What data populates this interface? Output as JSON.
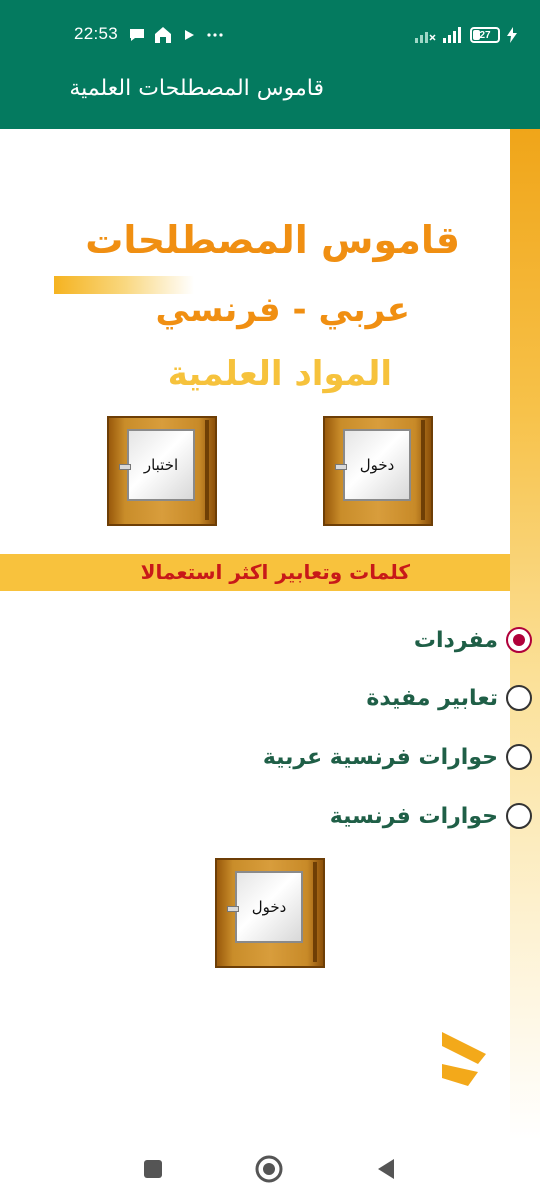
{
  "status_bar": {
    "time": "22:53",
    "battery": "27",
    "icons": [
      "chat-icon",
      "home-icon",
      "play-icon",
      "more-dots-icon",
      "signal-x-icon",
      "signal-icon",
      "battery-icon",
      "charging-icon"
    ]
  },
  "app_bar": {
    "title": "قاموس المصطلحات العلمية"
  },
  "header": {
    "title_line1": "قاموس المصطلحات",
    "title_line2": "عربي - فرنسي",
    "title_line3": "المواد العلمية"
  },
  "doors_top": {
    "left_label": "اختبار",
    "right_label": "دخول"
  },
  "banner": {
    "text": "كلمات وتعابير اكثر استعمالا"
  },
  "options": {
    "items": [
      {
        "label": "مفردات",
        "checked": true
      },
      {
        "label": "تعابير مفيدة",
        "checked": false
      },
      {
        "label": "حوارات  فرنسية عربية",
        "checked": false
      },
      {
        "label": "حوارات فرنسية",
        "checked": false
      }
    ]
  },
  "door_bottom": {
    "label": "دخول"
  },
  "colors": {
    "primary": "#047a5f",
    "accent_orange": "#f08f12",
    "accent_yellow": "#f6c23c",
    "banner_bg": "#f8c23d",
    "banner_text": "#c81919",
    "radio_checked": "#b0003a",
    "option_text": "#1f5f47"
  },
  "nav_bar": {
    "icons": [
      "recents-square-icon",
      "home-circle-icon",
      "back-triangle-icon"
    ]
  }
}
